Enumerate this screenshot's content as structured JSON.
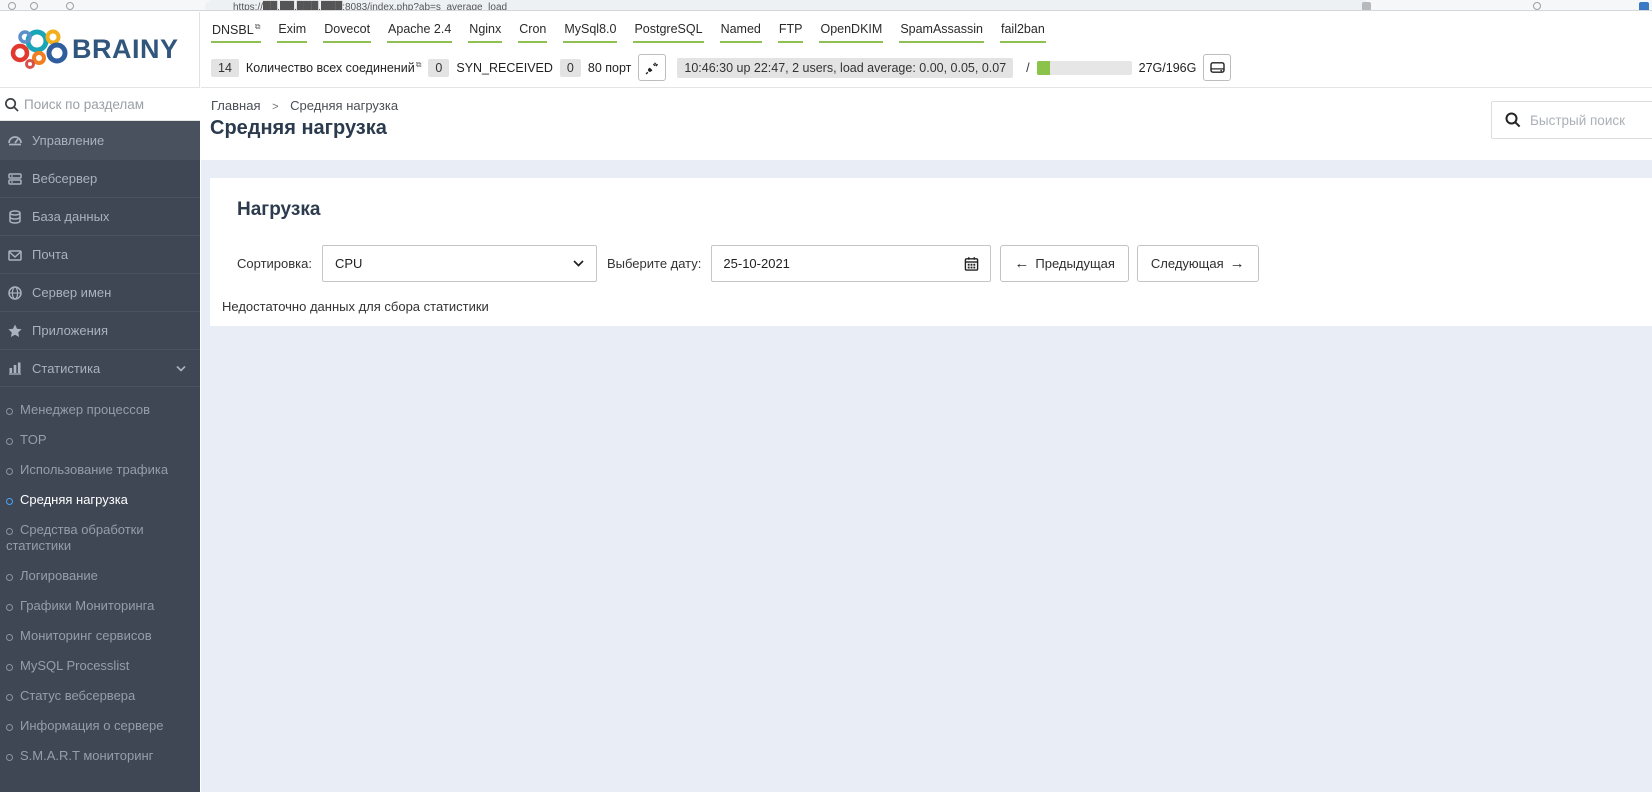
{
  "browser": {
    "url": "https://██.██.███.███:8083/index.php?ab=s_average_load"
  },
  "logo": {
    "text": "BRAINY"
  },
  "topbar": {
    "links": [
      {
        "label": "DNSBL",
        "external": true
      },
      {
        "label": "Exim"
      },
      {
        "label": "Dovecot"
      },
      {
        "label": "Apache 2.4"
      },
      {
        "label": "Nginx"
      },
      {
        "label": "Cron"
      },
      {
        "label": "MySql8.0"
      },
      {
        "label": "PostgreSQL"
      },
      {
        "label": "Named"
      },
      {
        "label": "FTP"
      },
      {
        "label": "OpenDKIM"
      },
      {
        "label": "SpamAssassin"
      },
      {
        "label": "fail2ban"
      }
    ],
    "status": {
      "connections_count": "14",
      "connections_label": "Количество всех соединений",
      "syn_count": "0",
      "syn_label": "SYN_RECEIVED",
      "port_count": "0",
      "port_label": "80 порт",
      "uptime": "10:46:30 up 22:47, 2 users, load average: 0.00, 0.05, 0.07",
      "disk_path": "/",
      "disk_usage": "27G/196G",
      "disk_percent": 14
    }
  },
  "sidebar": {
    "search_placeholder": "Поиск по разделам",
    "items": [
      "Управление",
      "Вебсервер",
      "База данных",
      "Почта",
      "Сервер имен",
      "Приложения",
      "Статистика"
    ],
    "stats_children": [
      "Менеджер процессов",
      "TOP",
      "Использование трафика",
      "Средняя нагрузка",
      "Средства обработки статистики",
      "Логирование",
      "Графики Мониторинга",
      "Мониторинг сервисов",
      "MySQL Processlist",
      "Статус вебсервера",
      "Информация о сервере",
      "S.M.A.R.T мониторинг"
    ],
    "active_item": "Средняя нагрузка"
  },
  "page": {
    "breadcrumb": [
      "Главная",
      "Средняя нагрузка"
    ],
    "breadcrumb_separator": ">",
    "title": "Средняя нагрузка",
    "quick_search_placeholder": "Быстрый поиск"
  },
  "panel": {
    "heading": "Нагрузка",
    "sort_label": "Сортировка:",
    "sort_value": "CPU",
    "date_label": "Выберите дату:",
    "date_value": "25-10-2021",
    "prev_button": "Предыдущая",
    "next_button": "Следующая",
    "prev_arrow": "←",
    "next_arrow": "→",
    "empty_message": "Недостаточно данных для сбора статистики"
  },
  "colors": {
    "accent_green": "#8fc152",
    "sidebar_bg": "#3f4654",
    "active_blue": "#4aa3f5",
    "title": "#2b3b4d"
  }
}
